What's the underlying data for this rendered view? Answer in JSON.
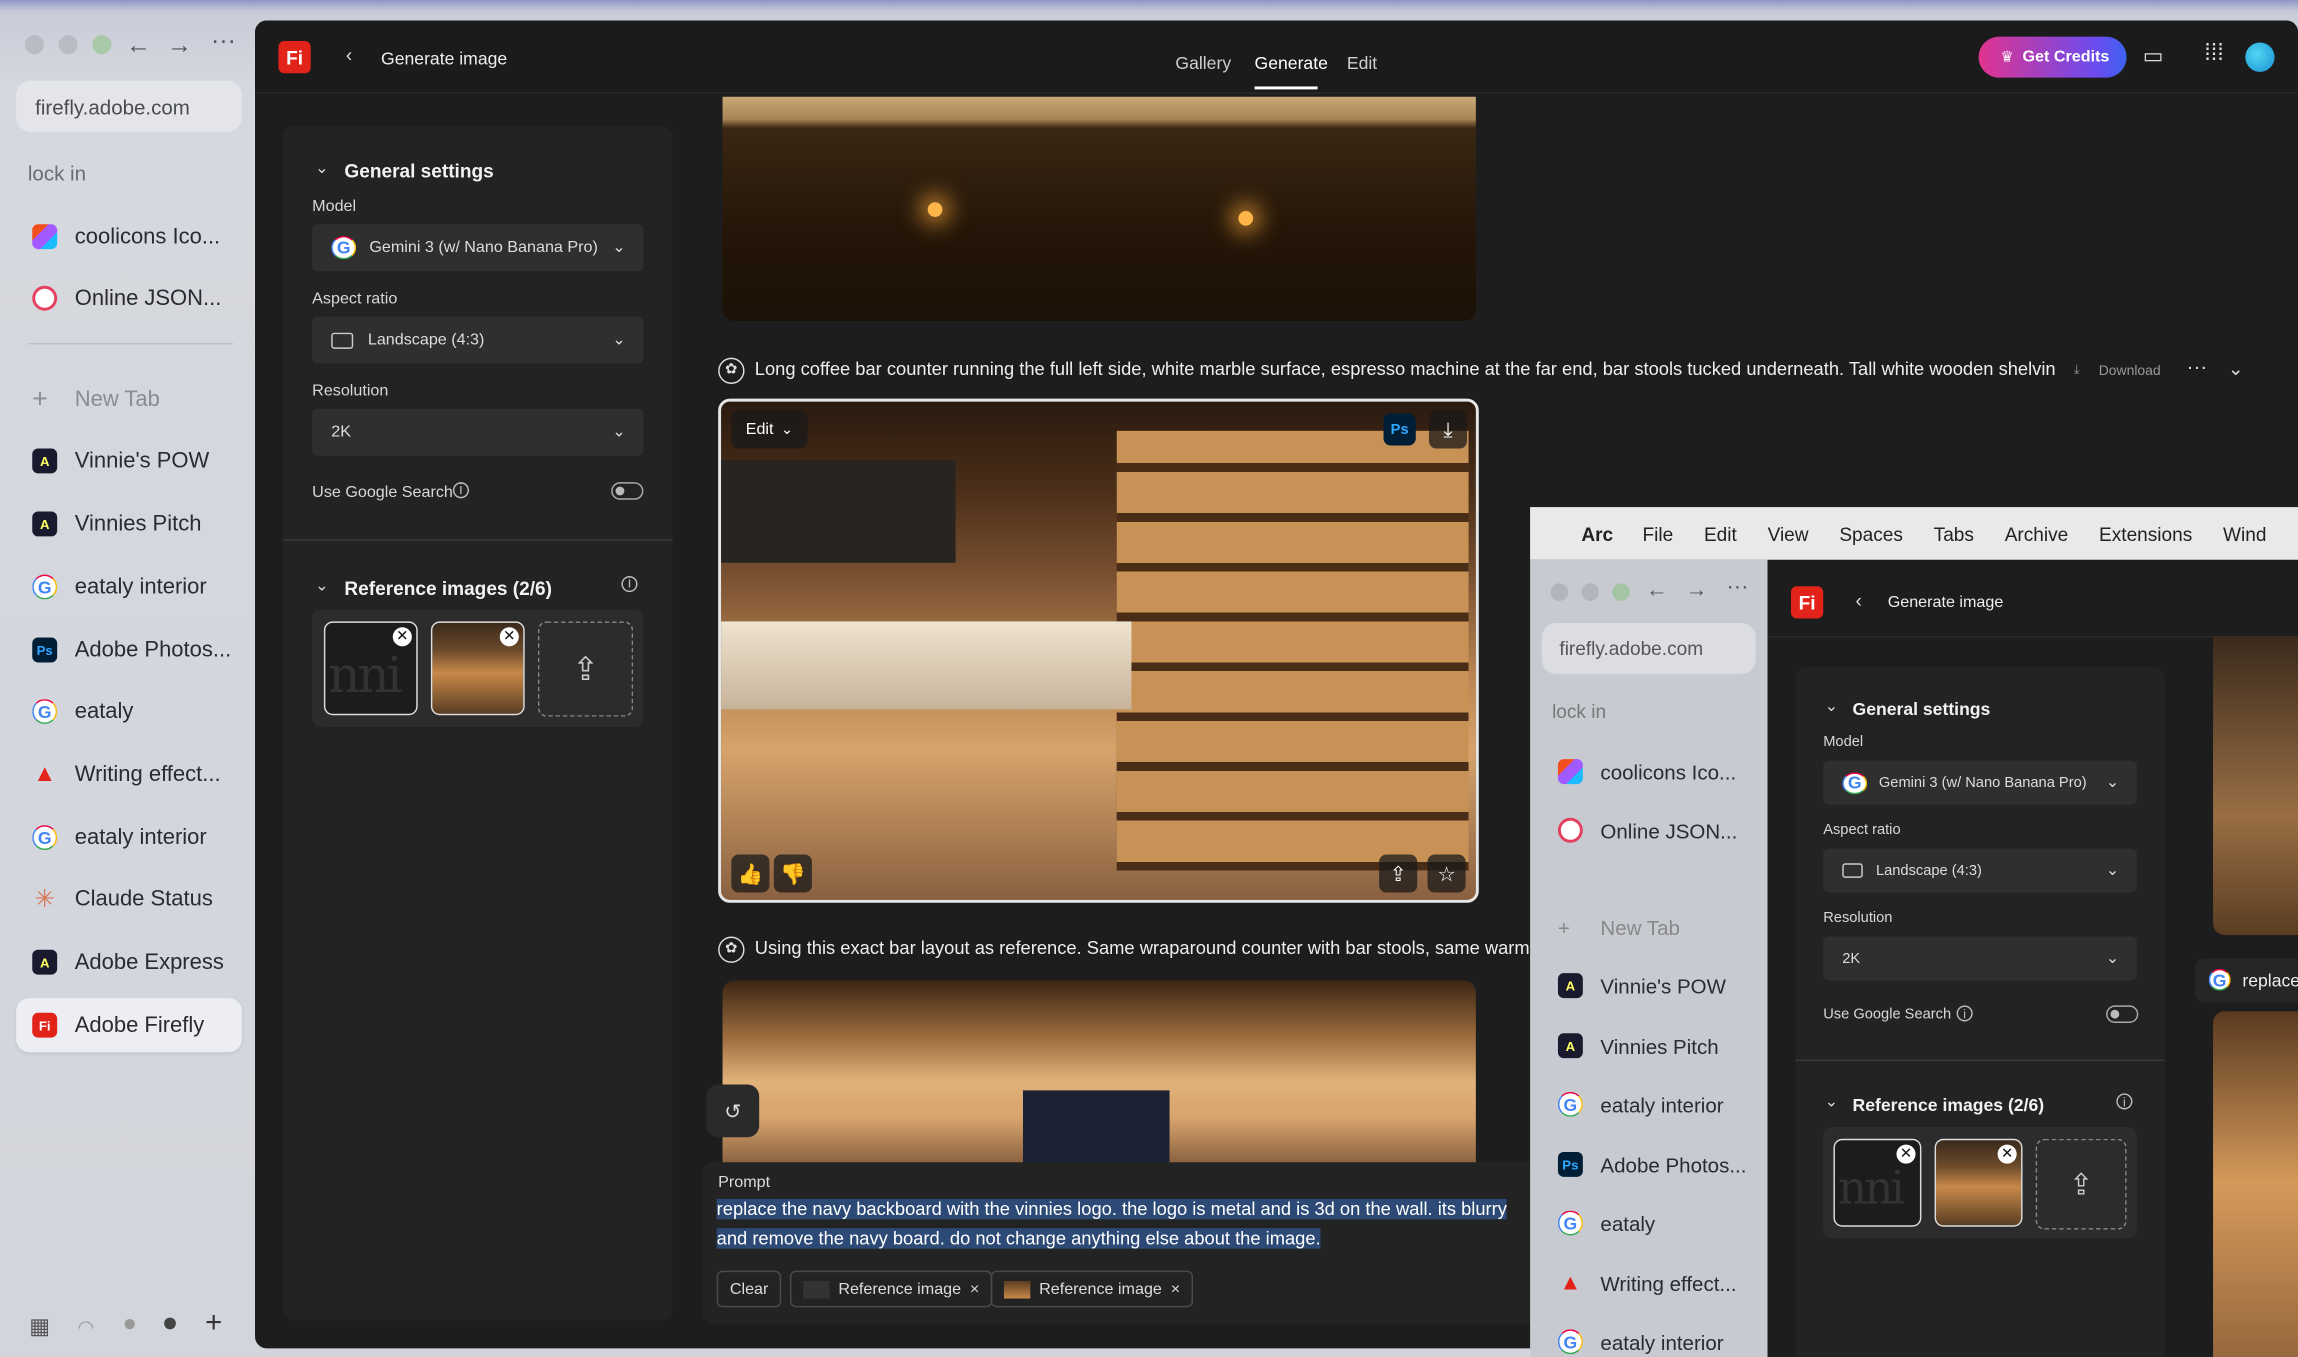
{
  "browser": {
    "url": "firefly.adobe.com",
    "section": "lock in",
    "pinned_tabs": [
      {
        "label": "coolicons Ico...",
        "icon": "figma-icon"
      },
      {
        "label": "Online JSON...",
        "icon": "json-icon"
      }
    ],
    "new_tab": "New Tab",
    "tabs": [
      {
        "label": "Vinnie's POW",
        "icon": "adobe-express-icon"
      },
      {
        "label": "Vinnies Pitch",
        "icon": "adobe-express-icon"
      },
      {
        "label": "eataly interior",
        "icon": "google-icon"
      },
      {
        "label": "Adobe Photos...",
        "icon": "photoshop-icon"
      },
      {
        "label": "eataly",
        "icon": "google-icon"
      },
      {
        "label": "Writing effect...",
        "icon": "adobe-icon"
      },
      {
        "label": "eataly interior",
        "icon": "google-icon"
      },
      {
        "label": "Claude Status",
        "icon": "claude-icon"
      },
      {
        "label": "Adobe Express",
        "icon": "adobe-express-icon"
      },
      {
        "label": "Adobe Firefly",
        "icon": "firefly-icon"
      }
    ]
  },
  "firefly": {
    "logo": "Fi",
    "back_title": "Generate image",
    "nav": [
      "Gallery",
      "Generate",
      "Edit"
    ],
    "active_nav": "Generate",
    "get_credits": "Get Credits",
    "general_settings": "General settings",
    "model_label": "Model",
    "model_value": "Gemini 3 (w/ Nano Banana Pro)",
    "aspect_label": "Aspect ratio",
    "aspect_value": "Landscape (4:3)",
    "resolution_label": "Resolution",
    "resolution_value": "2K",
    "google_search_label": "Use Google Search",
    "reference_title": "Reference images (2/6)",
    "ref_logo_text": "nni",
    "caption1": "Long coffee bar counter running the full left side, white marble surface, espresso machine at the far end, bar stools tucked underneath. Tall white wooden shelving un",
    "download": "Download",
    "edit_button": "Edit",
    "ps_badge": "Ps",
    "caption2": "Using this exact bar layout as reference. Same wraparound counter with bar stools, same warm wo",
    "prompt_label": "Prompt",
    "prompt_text": "replace the navy backboard with the vinnies logo. the logo is metal and is 3d on the wall. its blurry and remove the navy board. do not change anything else about the image.",
    "clear": "Clear",
    "chips": [
      "Reference image",
      "Reference image"
    ]
  },
  "arc": {
    "menu": [
      "Arc",
      "File",
      "Edit",
      "View",
      "Spaces",
      "Tabs",
      "Archive",
      "Extensions",
      "Wind"
    ],
    "replace_caption": "replace"
  },
  "colors": {
    "firefly_red": "#e2231a",
    "credits_gradient_start": "#e0348d",
    "credits_gradient_end": "#3d62f0"
  }
}
